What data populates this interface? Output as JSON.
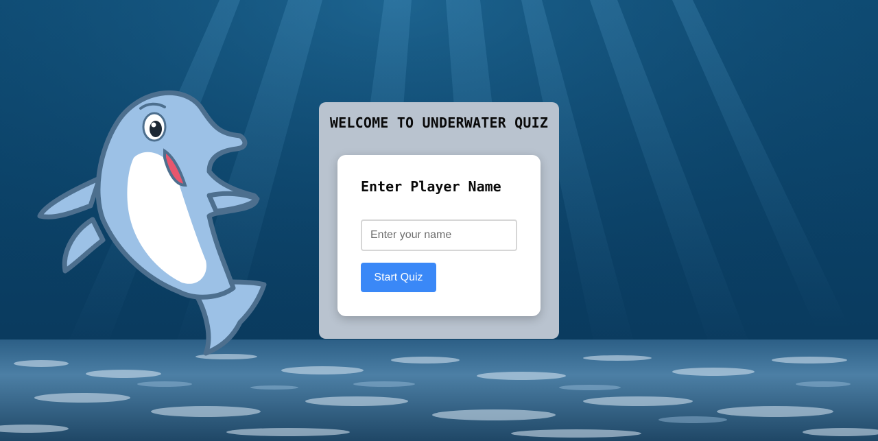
{
  "page": {
    "heading": "WELCOME TO UNDERWATER QUIZ"
  },
  "player_form": {
    "title": "Enter Player Name",
    "name_input": {
      "placeholder": "Enter your name",
      "value": ""
    },
    "start_button_label": "Start Quiz"
  },
  "background": {
    "scene": "underwater-ocean",
    "mascot": "dolphin-mascot"
  },
  "colors": {
    "ocean_deep": "#0a3b5f",
    "panel": "#b9c3cf",
    "card": "#ffffff",
    "button": "#3a88f7",
    "dolphin_body": "#9cc1e6",
    "dolphin_outline": "#4d6f8e"
  }
}
